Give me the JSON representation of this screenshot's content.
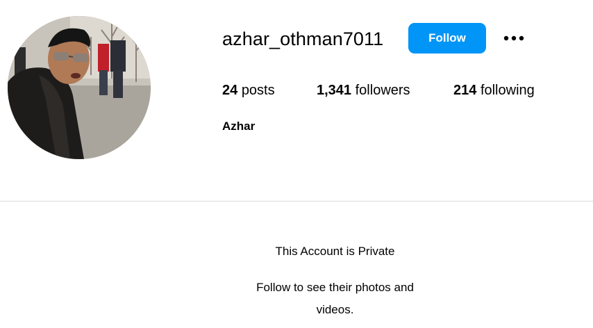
{
  "profile": {
    "username": "azhar_othman7011",
    "follow_label": "Follow",
    "more_icon": "more-options-icon",
    "full_name": "Azhar",
    "avatar_icon": "profile-photo"
  },
  "stats": {
    "posts_count": "24",
    "posts_label": "posts",
    "followers_count": "1,341",
    "followers_label": "followers",
    "following_count": "214",
    "following_label": "following"
  },
  "private_notice": {
    "title": "This Account is Private",
    "subtitle": "Follow to see their photos and videos."
  },
  "colors": {
    "accent": "#0095f6",
    "divider": "#dbdbdb",
    "text": "#000000"
  }
}
